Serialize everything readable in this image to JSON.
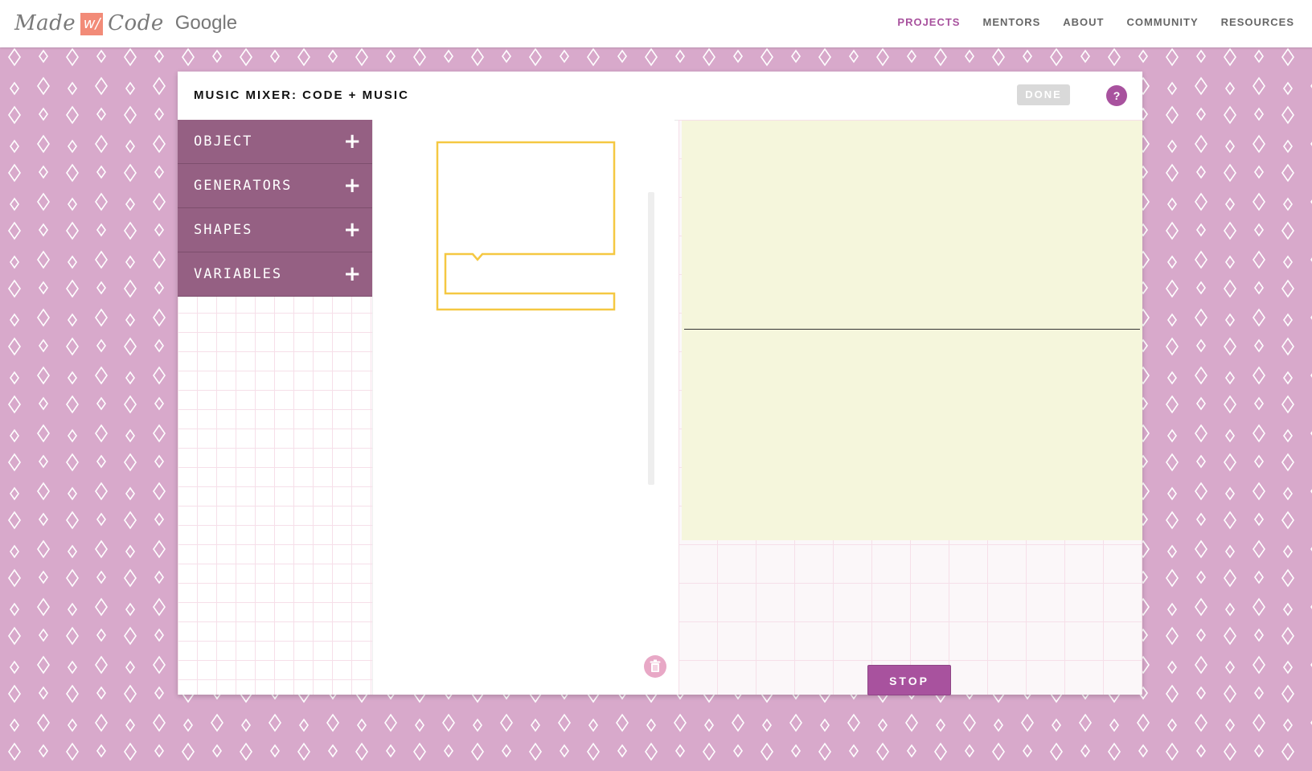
{
  "topbar": {
    "logo": {
      "made": "Made",
      "w": "w/",
      "code": "Code",
      "google": "Google"
    },
    "nav": [
      {
        "label": "PROJECTS",
        "active": true
      },
      {
        "label": "MENTORS",
        "active": false
      },
      {
        "label": "ABOUT",
        "active": false
      },
      {
        "label": "COMMUNITY",
        "active": false
      },
      {
        "label": "RESOURCES",
        "active": false
      }
    ]
  },
  "card": {
    "title": "MUSIC MIXER: CODE + MUSIC",
    "done_label": "DONE",
    "help_label": "?"
  },
  "toolbox": {
    "categories": [
      {
        "label": "OBJECT",
        "icon": "plus-icon"
      },
      {
        "label": "GENERATORS",
        "icon": "plus-icon"
      },
      {
        "label": "SHAPES",
        "icon": "plus-icon"
      },
      {
        "label": "VARIABLES",
        "icon": "plus-icon"
      }
    ]
  },
  "stage": {
    "stop_label": "STOP"
  },
  "colors": {
    "accent": "#a8529e",
    "category_bg": "#956083",
    "block_outline": "#f5c842",
    "stage_bg": "#f5f6dc",
    "page_bg": "#d8a9cb",
    "trash": "#e8a8c6"
  }
}
